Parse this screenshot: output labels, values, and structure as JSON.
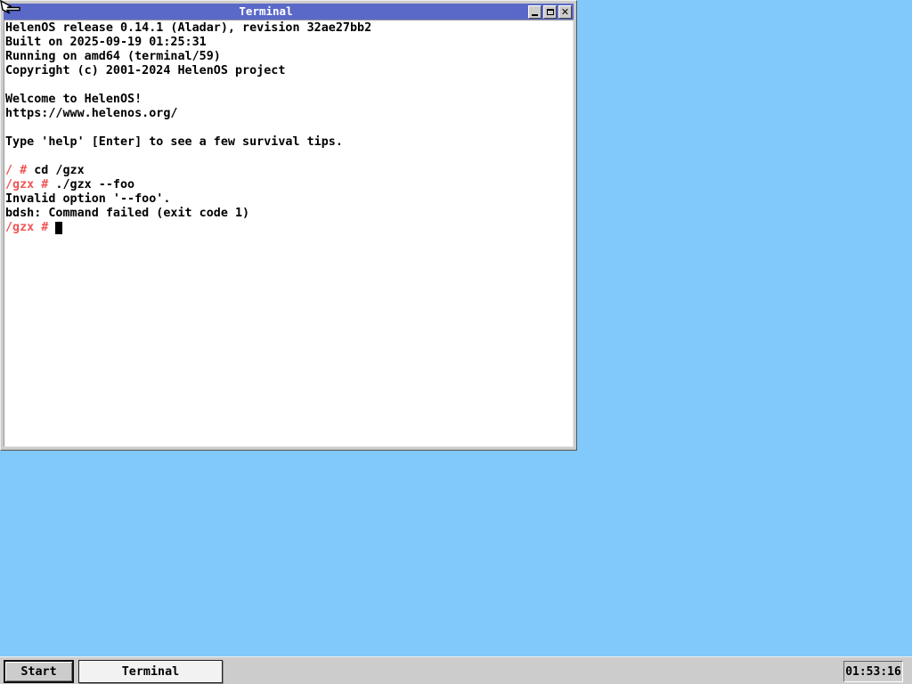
{
  "desktop": {
    "background_color": "#81c9fa"
  },
  "window": {
    "title": "Terminal",
    "titlebar_color": "#5a69c8",
    "controls": [
      {
        "icon": "minimize-icon"
      },
      {
        "icon": "maximize-icon"
      },
      {
        "icon": "close-icon"
      }
    ]
  },
  "terminal": {
    "text_color": "#000000",
    "prompt_color": "#ee5555",
    "background_color": "#ffffff",
    "lines": [
      {
        "segments": [
          {
            "text": "HelenOS release 0.14.1 (Aladar), revision 32ae27bb2",
            "color": "black"
          }
        ]
      },
      {
        "segments": [
          {
            "text": "Built on 2025-09-19 01:25:31",
            "color": "black"
          }
        ]
      },
      {
        "segments": [
          {
            "text": "Running on amd64 (terminal/59)",
            "color": "black"
          }
        ]
      },
      {
        "segments": [
          {
            "text": "Copyright (c) 2001-2024 HelenOS project",
            "color": "black"
          }
        ]
      },
      {
        "segments": []
      },
      {
        "segments": [
          {
            "text": "Welcome to HelenOS!",
            "color": "black"
          }
        ]
      },
      {
        "segments": [
          {
            "text": "https://www.helenos.org/",
            "color": "black"
          }
        ]
      },
      {
        "segments": []
      },
      {
        "segments": [
          {
            "text": "Type 'help' [Enter] to see a few survival tips.",
            "color": "black"
          }
        ]
      },
      {
        "segments": []
      },
      {
        "segments": [
          {
            "text": "/ #",
            "color": "red"
          },
          {
            "text": " cd /gzx",
            "color": "black"
          }
        ]
      },
      {
        "segments": [
          {
            "text": "/gzx #",
            "color": "red"
          },
          {
            "text": " ./gzx --foo",
            "color": "black"
          }
        ]
      },
      {
        "segments": [
          {
            "text": "Invalid option '--foo'.",
            "color": "black"
          }
        ]
      },
      {
        "segments": [
          {
            "text": "bdsh: Command failed (exit code 1)",
            "color": "black"
          }
        ]
      },
      {
        "segments": [
          {
            "text": "/gzx # ",
            "color": "red"
          }
        ],
        "cursor": true
      }
    ]
  },
  "taskbar": {
    "start_label": "Start",
    "task_buttons": [
      {
        "label": "Terminal"
      }
    ],
    "clock": "01:53:16"
  }
}
